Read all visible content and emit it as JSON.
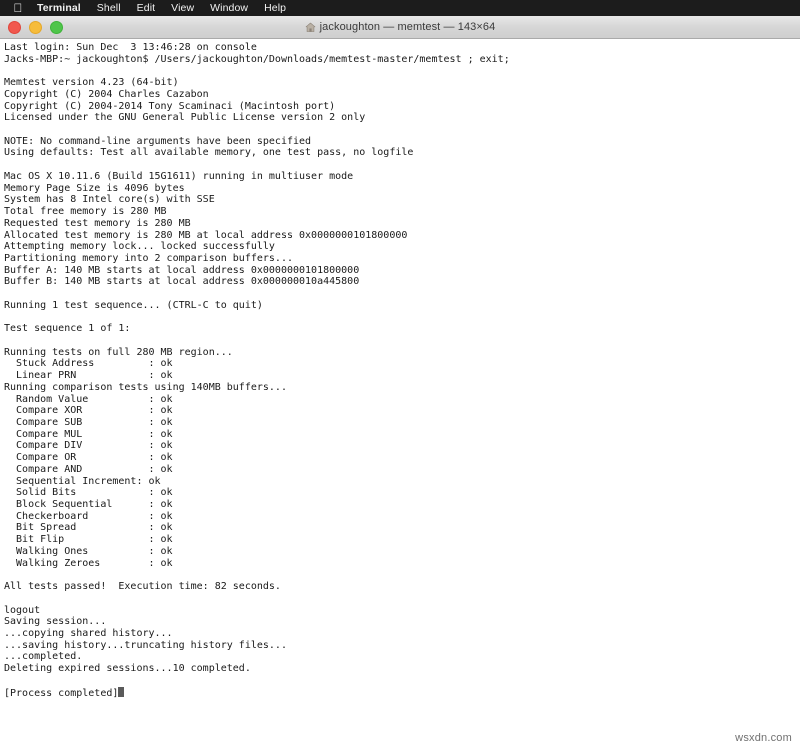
{
  "menubar": {
    "apple_logo_icon": "apple-logo-icon",
    "items": [
      {
        "label": "Terminal",
        "bold": true
      },
      {
        "label": "Shell",
        "bold": false
      },
      {
        "label": "Edit",
        "bold": false
      },
      {
        "label": "View",
        "bold": false
      },
      {
        "label": "Window",
        "bold": false
      },
      {
        "label": "Help",
        "bold": false
      }
    ],
    "background_color": "#1c1c1c",
    "text_color": "#f2f2f2"
  },
  "window": {
    "title": "jackoughton — memtest — 143×64",
    "home_icon": "home-icon",
    "traffic_lights": {
      "close_color": "#f1584e",
      "minimize_color": "#f6bc3b",
      "zoom_color": "#4fc54a"
    },
    "background_color": "#ffffff",
    "text_color": "#1a1a1a"
  },
  "terminal": {
    "lines": [
      "Last login: Sun Dec  3 13:46:28 on console",
      "Jacks-MBP:~ jackoughton$ /Users/jackoughton/Downloads/memtest-master/memtest ; exit;",
      "",
      "Memtest version 4.23 (64-bit)",
      "Copyright (C) 2004 Charles Cazabon",
      "Copyright (C) 2004-2014 Tony Scaminaci (Macintosh port)",
      "Licensed under the GNU General Public License version 2 only",
      "",
      "NOTE: No command-line arguments have been specified",
      "Using defaults: Test all available memory, one test pass, no logfile",
      "",
      "Mac OS X 10.11.6 (Build 15G1611) running in multiuser mode",
      "Memory Page Size is 4096 bytes",
      "System has 8 Intel core(s) with SSE",
      "Total free memory is 280 MB",
      "Requested test memory is 280 MB",
      "Allocated test memory is 280 MB at local address 0x0000000101800000",
      "Attempting memory lock... locked successfully",
      "Partitioning memory into 2 comparison buffers...",
      "Buffer A: 140 MB starts at local address 0x0000000101800000",
      "Buffer B: 140 MB starts at local address 0x000000010a445800",
      "",
      "Running 1 test sequence... (CTRL-C to quit)",
      "",
      "Test sequence 1 of 1:",
      "",
      "Running tests on full 280 MB region...",
      "  Stuck Address         : ok",
      "  Linear PRN            : ok",
      "Running comparison tests using 140MB buffers...",
      "  Random Value          : ok",
      "  Compare XOR           : ok",
      "  Compare SUB           : ok",
      "  Compare MUL           : ok",
      "  Compare DIV           : ok",
      "  Compare OR            : ok",
      "  Compare AND           : ok",
      "  Sequential Increment: ok",
      "  Solid Bits            : ok",
      "  Block Sequential      : ok",
      "  Checkerboard          : ok",
      "  Bit Spread            : ok",
      "  Bit Flip              : ok",
      "  Walking Ones          : ok",
      "  Walking Zeroes        : ok",
      "",
      "All tests passed!  Execution time: 82 seconds.",
      "",
      "logout",
      "Saving session...",
      "...copying shared history...",
      "...saving history...truncating history files...",
      "...completed.",
      "Deleting expired sessions...10 completed.",
      "",
      "[Process completed]"
    ]
  },
  "watermark": {
    "text": "wsxdn.com"
  }
}
